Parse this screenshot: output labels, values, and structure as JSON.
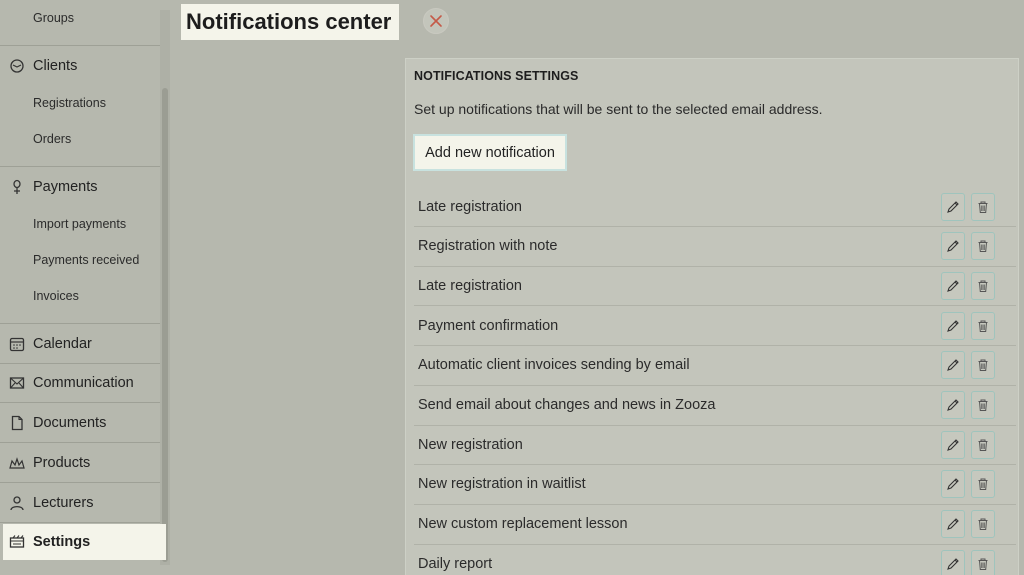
{
  "sidebar": {
    "groups_label": "Groups",
    "clients_label": "Clients",
    "registrations_label": "Registrations",
    "orders_label": "Orders",
    "payments_label": "Payments",
    "import_payments_label": "Import payments",
    "payments_received_label": "Payments received",
    "invoices_label": "Invoices",
    "calendar_label": "Calendar",
    "communication_label": "Communication",
    "documents_label": "Documents",
    "products_label": "Products",
    "lecturers_label": "Lecturers",
    "settings_label": "Settings"
  },
  "header": {
    "title": "Notifications center"
  },
  "panel": {
    "heading": "NOTIFICATIONS SETTINGS",
    "description": "Set up notifications that will be sent to the selected email address.",
    "add_button_label": "Add new notification"
  },
  "notifications": [
    {
      "label": "Late registration"
    },
    {
      "label": "Registration with note"
    },
    {
      "label": "Late registration"
    },
    {
      "label": "Payment confirmation"
    },
    {
      "label": "Automatic client invoices sending by email"
    },
    {
      "label": "Send email about changes and news in Zooza"
    },
    {
      "label": "New registration"
    },
    {
      "label": "New registration in waitlist"
    },
    {
      "label": "New custom replacement lesson"
    },
    {
      "label": "Daily report"
    }
  ],
  "icons": {
    "edit": "pencil-icon",
    "delete": "trash-icon",
    "close": "close-icon"
  },
  "colors": {
    "background": "#b6b8ae",
    "highlight": "#f4f4ea",
    "close_accent": "#c45a48",
    "button_border": "#9fc4bd"
  }
}
